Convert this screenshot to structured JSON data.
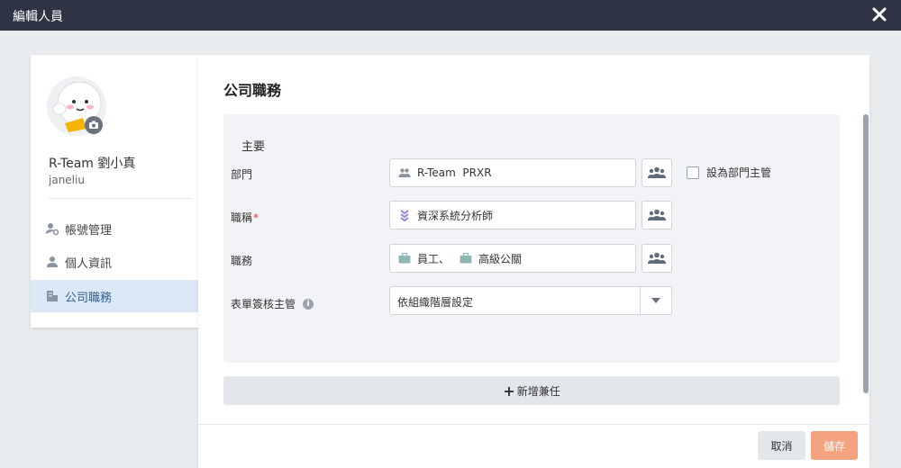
{
  "window": {
    "title": "編輯人員"
  },
  "profile": {
    "name": "R-Team 劉小真",
    "id": "janeliu"
  },
  "sidebar": {
    "items": [
      {
        "label": "帳號管理",
        "icon": "account-settings-icon"
      },
      {
        "label": "個人資訊",
        "icon": "person-icon"
      },
      {
        "label": "公司職務",
        "icon": "building-icon",
        "active": true
      }
    ]
  },
  "main": {
    "title": "公司職務",
    "section_title": "主要",
    "department": {
      "label": "部門",
      "value": "R-Team  PRXR"
    },
    "set_manager_label": "設為部門主管",
    "job_title": {
      "label": "職稱",
      "required_mark": "*",
      "value": "資深系統分析師"
    },
    "duty": {
      "label": "職務",
      "value1": "員工、",
      "value2": "高級公關"
    },
    "approver": {
      "label": "表單簽核主管",
      "value": "依組織階層設定"
    },
    "add_concurrent_label": "新增兼任"
  },
  "footer": {
    "cancel_label": "取消",
    "save_label": "儲存"
  },
  "colors": {
    "titlebar": "#2f3444",
    "accent": "#f5a27f",
    "active_item_bg": "#dbe8f7"
  }
}
